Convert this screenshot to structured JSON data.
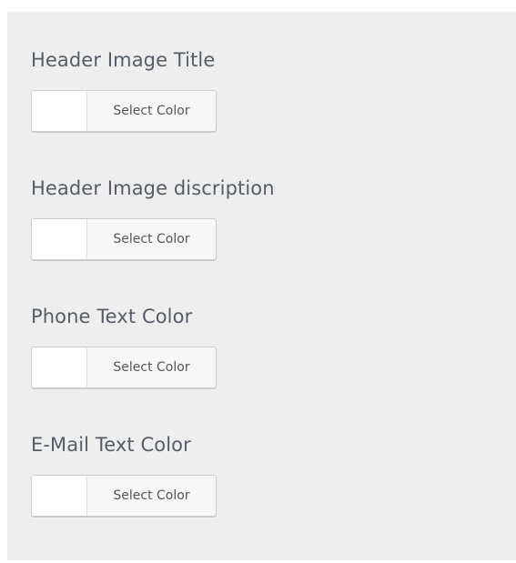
{
  "sections": [
    {
      "title": "Header Image Title",
      "button_label": "Select Color",
      "swatch_color": "#ffffff"
    },
    {
      "title": "Header Image discription",
      "button_label": "Select Color",
      "swatch_color": "#ffffff"
    },
    {
      "title": "Phone Text Color",
      "button_label": "Select Color",
      "swatch_color": "#ffffff"
    },
    {
      "title": "E-Mail Text Color",
      "button_label": "Select Color",
      "swatch_color": "#ffffff"
    }
  ],
  "colors": {
    "panel_background": "#eeeeee",
    "title_text": "#555d66",
    "button_text": "#555555"
  }
}
